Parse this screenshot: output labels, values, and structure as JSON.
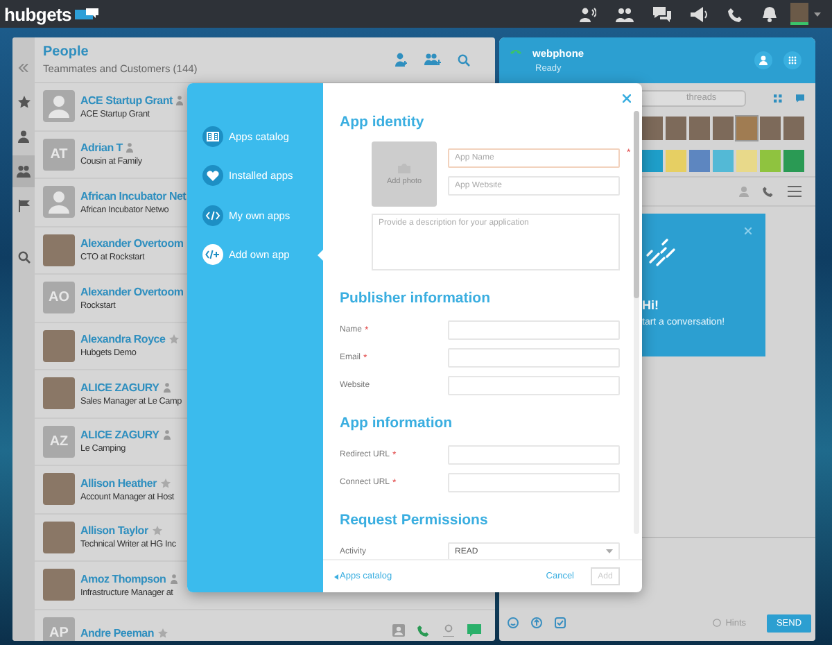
{
  "top_bar": {
    "logo": "hubgets"
  },
  "people": {
    "title": "People",
    "subtitle": "Teammates and Customers (144)",
    "rail": [
      {
        "kind": "collapse",
        "selected": false
      },
      {
        "kind": "star",
        "selected": false
      },
      {
        "kind": "person",
        "selected": false
      },
      {
        "kind": "team",
        "selected": true
      },
      {
        "kind": "flag",
        "selected": false
      },
      {
        "kind": "search",
        "selected": false
      }
    ],
    "contacts": [
      {
        "name": "ACE Startup Grant",
        "subtitle": "ACE Startup Grant",
        "avatar": {
          "kind": "silhouette"
        },
        "badge": {
          "kind": "person"
        }
      },
      {
        "name": "Adrian T",
        "subtitle": "Cousin at Family",
        "avatar": {
          "kind": "initials",
          "initials": "AT"
        },
        "badge": {
          "kind": "person"
        }
      },
      {
        "name": "African Incubator Net",
        "subtitle": "African Incubator Netwo",
        "avatar": {
          "kind": "silhouette"
        }
      },
      {
        "name": "Alexander Overtoom",
        "subtitle": "CTO at Rockstart",
        "avatar": {
          "kind": "photo"
        }
      },
      {
        "name": "Alexander Overtoom",
        "subtitle": "Rockstart",
        "avatar": {
          "kind": "initials",
          "initials": "AO"
        }
      },
      {
        "name": "Alexandra Royce",
        "subtitle": "Hubgets Demo",
        "avatar": {
          "kind": "photo"
        },
        "badge": {
          "kind": "star"
        }
      },
      {
        "name": "ALICE ZAGURY",
        "subtitle": "Sales Manager at Le Camp",
        "avatar": {
          "kind": "photo"
        },
        "badge": {
          "kind": "person"
        }
      },
      {
        "name": "ALICE ZAGURY",
        "subtitle": "Le Camping",
        "avatar": {
          "kind": "initials",
          "initials": "AZ"
        },
        "badge": {
          "kind": "person"
        }
      },
      {
        "name": "Allison Heather",
        "subtitle": "Account Manager at Host",
        "avatar": {
          "kind": "photo"
        },
        "badge": {
          "kind": "star"
        }
      },
      {
        "name": "Allison Taylor",
        "subtitle": "Technical Writer at HG Inc",
        "avatar": {
          "kind": "photo"
        },
        "badge": {
          "kind": "star"
        }
      },
      {
        "name": "Amoz Thompson",
        "subtitle": "Infrastructure Manager at",
        "avatar": {
          "kind": "photo"
        },
        "badge": {
          "kind": "person"
        }
      },
      {
        "name": "Andre Peeman",
        "avatar": {
          "kind": "initials",
          "initials": "AP"
        },
        "badge": {
          "kind": "star"
        }
      }
    ]
  },
  "webphone": {
    "title": "webphone",
    "status": "Ready",
    "search_placeholder": "threads",
    "photos": [
      {
        "selected": false
      },
      {
        "selected": false
      },
      {
        "selected": false
      },
      {
        "selected": false
      },
      {
        "selected": true
      },
      {
        "selected": false
      },
      {
        "selected": false
      }
    ],
    "stickers": [
      {
        "color": "#1e9ec9"
      },
      {
        "color": "#e6cf63"
      },
      {
        "color": "#5d86c0"
      },
      {
        "color": "#53b9d6"
      },
      {
        "color": "#e8d98a"
      },
      {
        "color": "#8fc33f"
      },
      {
        "color": "#2a9a54"
      }
    ],
    "greeting": {
      "title": "Hi!",
      "text": "tart a conversation!"
    },
    "hints": "Hints",
    "send": "SEND"
  },
  "modal": {
    "nav": [
      {
        "label": "Apps catalog",
        "kind": "catalog",
        "selected": false
      },
      {
        "label": "Installed apps",
        "kind": "installed",
        "selected": false
      },
      {
        "label": "My own apps",
        "kind": "own",
        "selected": false
      },
      {
        "label": "Add own app",
        "kind": "add",
        "selected": true
      }
    ],
    "identity": {
      "heading": "App identity",
      "add_photo": "Add photo",
      "fields": [
        {
          "placeholder": "App Name",
          "mark": "*",
          "highlighted": true
        },
        {
          "placeholder": "App Website",
          "highlighted": false
        }
      ],
      "description_placeholder": "Provide a description for your application"
    },
    "sections": [
      {
        "heading": "Publisher information",
        "rows": [
          {
            "label": "Name",
            "mark": "*"
          },
          {
            "label": "Email",
            "mark": "*"
          },
          {
            "label": "Website"
          }
        ]
      },
      {
        "heading": "App information",
        "rows": [
          {
            "label": "Redirect URL",
            "mark": "*"
          },
          {
            "label": "Connect URL",
            "mark": "*"
          }
        ]
      },
      {
        "heading": "Request Permissions",
        "rows": [
          {
            "label": "Activity",
            "kind": "select",
            "value": "READ"
          }
        ]
      }
    ],
    "back": "Apps catalog",
    "cancel": "Cancel",
    "add": "Add",
    "add_disabled": true
  }
}
